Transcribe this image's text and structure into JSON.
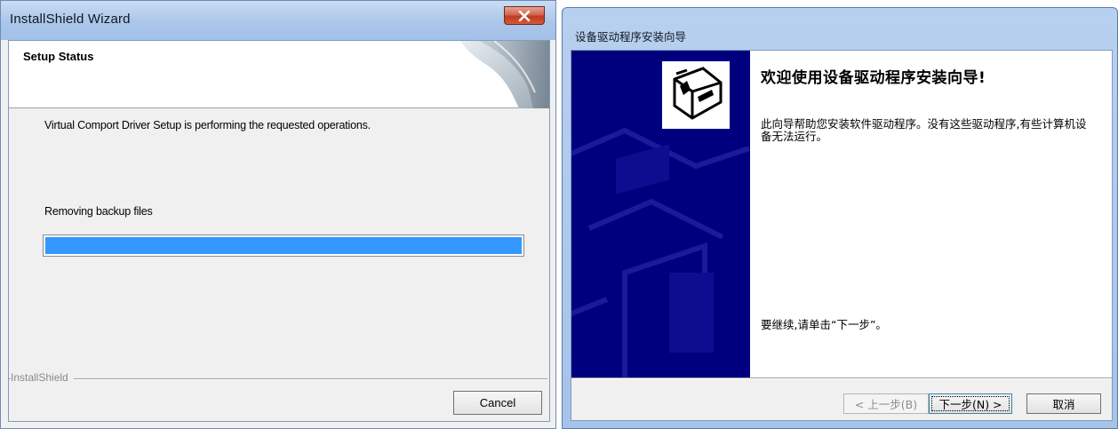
{
  "left_window": {
    "title": "InstallShield Wizard",
    "header_title": "Setup Status",
    "status_message": "Virtual Comport Driver Setup is performing the requested operations.",
    "progress_caption": "Removing backup files",
    "progress_fraction": 1.0,
    "brand": "InstallShield",
    "cancel_label": "Cancel"
  },
  "right_window": {
    "title": "设备驱动程序安装向导",
    "welcome_title": "欢迎使用设备驱动程序安装向导!",
    "welcome_body": "此向导帮助您安装软件驱动程序。没有这些驱动程序,有些计算机设备无法运行。",
    "continue_text": "要继续,请单击“下一步”。",
    "back_label": "< 上一步(B)",
    "next_label": "下一步(N) >",
    "cancel_label": "取消"
  },
  "colors": {
    "progress_fill": "#3399ff",
    "side_panel": "#00007f",
    "close_button": "#c8452b"
  },
  "icons": {
    "close": "close-icon",
    "wizard_art": "installshield-corner-art",
    "driver": "hardware-driver-icon"
  }
}
